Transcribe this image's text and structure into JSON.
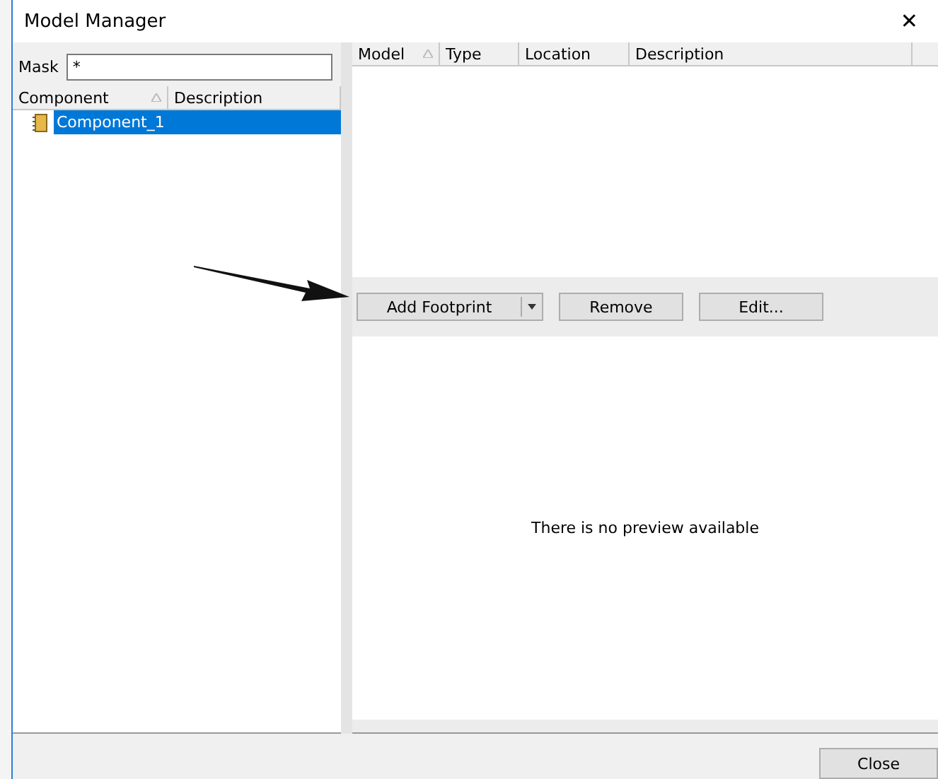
{
  "window": {
    "title": "Model Manager",
    "close_glyph": "✕"
  },
  "mask": {
    "label": "Mask",
    "value": "*"
  },
  "components": {
    "columns": [
      {
        "label": "Component",
        "sorted": true
      },
      {
        "label": "Description",
        "sorted": false
      }
    ],
    "rows": [
      {
        "name": "Component_1",
        "selected": true
      }
    ]
  },
  "models": {
    "columns": [
      {
        "label": "Model",
        "sorted": true
      },
      {
        "label": "Type",
        "sorted": false
      },
      {
        "label": "Location",
        "sorted": false
      },
      {
        "label": "Description",
        "sorted": false
      }
    ]
  },
  "buttons": [
    {
      "kind": "split",
      "label": "Add Footprint"
    },
    {
      "kind": "plain",
      "label": "Remove"
    },
    {
      "kind": "plain",
      "label": "Edit..."
    }
  ],
  "preview": {
    "message": "There is no preview available"
  },
  "footer": {
    "close": "Close"
  }
}
